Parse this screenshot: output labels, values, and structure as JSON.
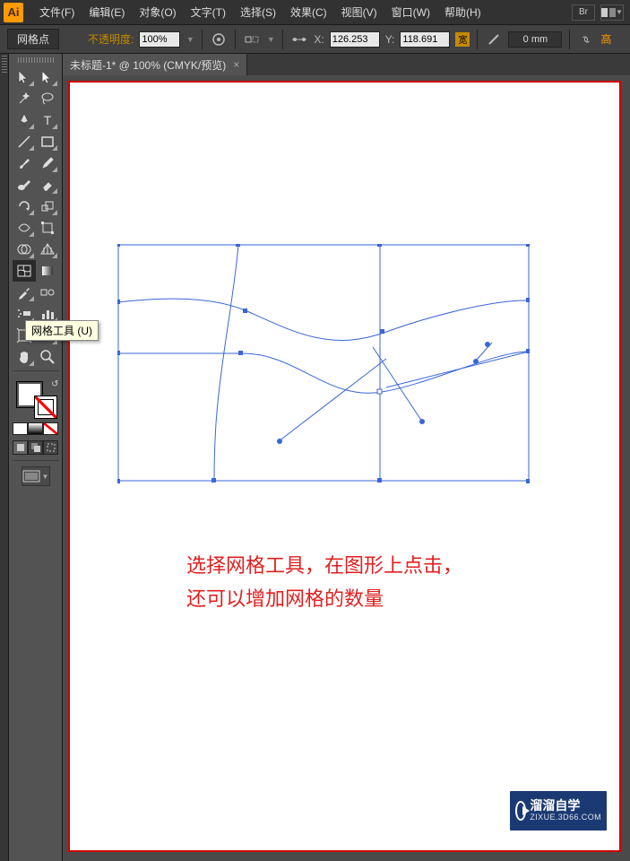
{
  "app": {
    "logo": "Ai"
  },
  "menu": {
    "file": "文件(F)",
    "edit": "编辑(E)",
    "object": "对象(O)",
    "type": "文字(T)",
    "select": "选择(S)",
    "effect": "效果(C)",
    "view": "视图(V)",
    "window": "窗口(W)",
    "help": "帮助(H)",
    "br": "Br"
  },
  "options": {
    "context_label": "网格点",
    "opacity_label": "不透明度:",
    "opacity_value": "100%",
    "x_label": "X:",
    "x_value": "126.253",
    "y_label": "Y:",
    "y_value": "118.691",
    "width_badge": "宽",
    "stroke_value": "0 mm",
    "extra": "高"
  },
  "doc_tab": {
    "title": "未标题-1* @ 100% (CMYK/预览)",
    "close": "×"
  },
  "tooltip": "网格工具 (U)",
  "annotation": {
    "line1": "选择网格工具，在图形上点击，",
    "line2": "还可以增加网格的数量"
  },
  "watermark": {
    "main": "溜溜自学",
    "sub": "ZIXUE.3D66.COM"
  },
  "tools": {
    "selection": "selection-tool",
    "direct": "direct-selection-tool",
    "magicwand": "magic-wand-tool",
    "lasso": "lasso-tool",
    "pen": "pen-tool",
    "type": "type-tool",
    "line": "line-segment-tool",
    "rectangle": "rectangle-tool",
    "brush": "paintbrush-tool",
    "pencil": "pencil-tool",
    "blob": "blob-brush-tool",
    "eraser": "eraser-tool",
    "rotate": "rotate-tool",
    "reflect": "scale-tool",
    "width": "width-tool",
    "free": "free-transform-tool",
    "shapebuilder": "shape-builder-tool",
    "perspective": "perspective-grid-tool",
    "mesh": "mesh-tool",
    "gradient": "gradient-tool",
    "eyedrop": "eyedropper-tool",
    "blend": "blend-tool",
    "symbol": "symbol-sprayer-tool",
    "graph": "column-graph-tool",
    "artboard": "artboard-tool",
    "slice": "slice-tool",
    "hand": "hand-tool",
    "zoom": "zoom-tool"
  }
}
